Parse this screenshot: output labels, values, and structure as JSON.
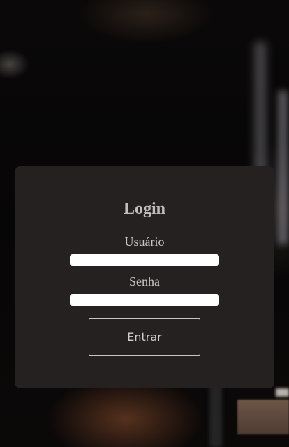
{
  "login": {
    "title": "Login",
    "username_label": "Usuário",
    "username_value": "",
    "password_label": "Senha",
    "password_value": "",
    "submit_label": "Entrar"
  },
  "colors": {
    "card_background": "#242120",
    "text": "#c8c5c4",
    "field_background": "#ffffff"
  }
}
